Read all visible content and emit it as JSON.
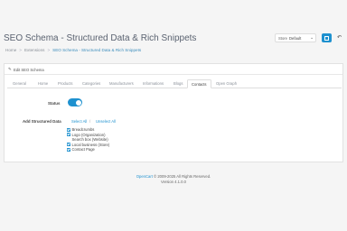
{
  "header": {
    "title": "SEO Schema - Structured Data & Rich Snippets",
    "breadcrumb": [
      "Home",
      "Extensions",
      "SEO Schema - Structured Data & Rich Snippets"
    ],
    "store_label": "Store",
    "store_value": "Default",
    "save_icon": "save-icon",
    "back_icon": "reply-icon"
  },
  "panel": {
    "heading": "Edit SEO Schema",
    "tabs": [
      "General",
      "Home",
      "Products",
      "Categories",
      "Manufacturers",
      "Informations",
      "Blogs",
      "Contacts",
      "Open Graph"
    ],
    "active_tab": "Contacts",
    "status_label": "Status",
    "status_on": true,
    "structured_label": "Add Structured Data",
    "select_all": "Select All",
    "separator": "/",
    "unselect_all": "Unselect All",
    "items": [
      {
        "label": "Breadcrumbs",
        "checked": true
      },
      {
        "label": "Logo (Organization)",
        "checked": true
      },
      {
        "label": "Search box (Website)",
        "checked": false
      },
      {
        "label": "Local business (Store)",
        "checked": true
      },
      {
        "label": "Contact Page",
        "checked": true
      }
    ]
  },
  "footer": {
    "brand": "OpenCart",
    "copyright": "© 2009-2025 All Rights Reserved.",
    "version": "Version 4.1.0.0"
  },
  "colors": {
    "accent": "#1e91cf",
    "link": "#3c8dbc"
  }
}
